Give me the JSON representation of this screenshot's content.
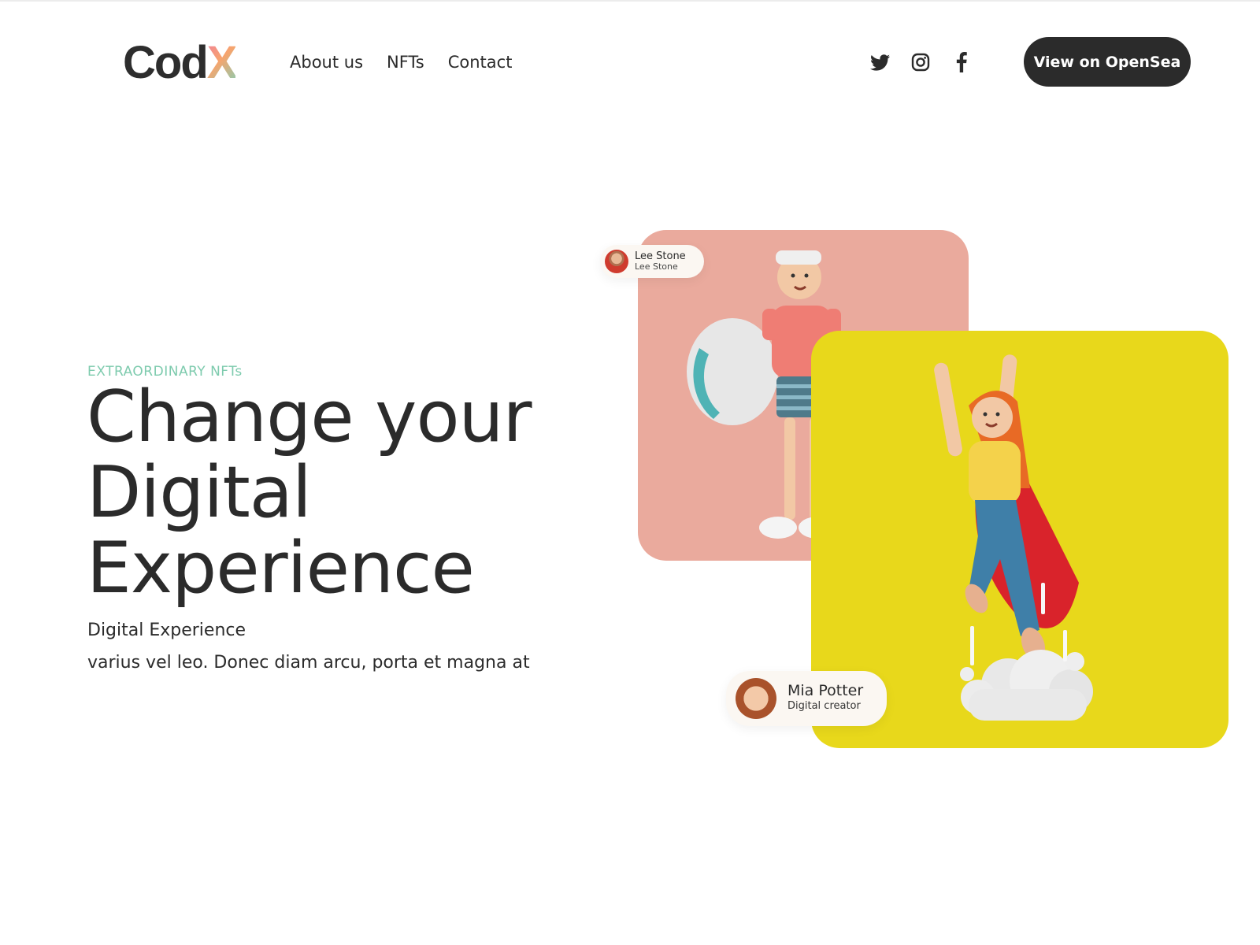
{
  "header": {
    "logo": {
      "text_main": "Cod",
      "text_accent": "X"
    },
    "nav": [
      {
        "label": "About us"
      },
      {
        "label": "NFTs"
      },
      {
        "label": "Contact"
      }
    ],
    "socials": [
      {
        "icon": "twitter-icon"
      },
      {
        "icon": "instagram-icon"
      },
      {
        "icon": "facebook-icon"
      }
    ],
    "cta_label": "View on OpenSea"
  },
  "hero": {
    "eyebrow": "EXTRAORDINARY NFTs",
    "headline": "Change your Digital Experience",
    "subtitle": "Digital Experience",
    "body": "varius vel leo. Donec diam arcu, porta et magna at"
  },
  "cards": [
    {
      "background": "#eaaa9d",
      "creator_name": "Lee Stone",
      "creator_role": "Lee Stone",
      "image": "3d-boy-with-surfboard"
    },
    {
      "background": "#e8d81b",
      "creator_name": "Mia Potter",
      "creator_role": "Digital creator",
      "image": "3d-girl-flying-with-cape"
    }
  ],
  "colors": {
    "accent_mint": "#7ecbae",
    "text_dark": "#2b2b2b",
    "button_bg": "#2b2b2b"
  }
}
